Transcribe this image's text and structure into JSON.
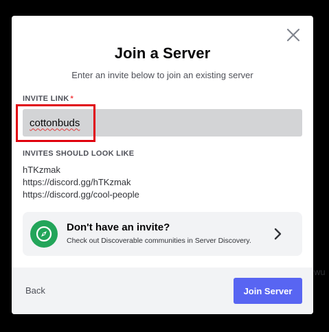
{
  "modal": {
    "title": "Join a Server",
    "subtitle": "Enter an invite below to join an existing server"
  },
  "invite_field": {
    "label": "INVITE LINK",
    "required_marker": "*",
    "value": "cottonbuds"
  },
  "examples": {
    "label": "INVITES SHOULD LOOK LIKE",
    "items": [
      "hTKzmak",
      "https://discord.gg/hTKzmak",
      "https://discord.gg/cool-people"
    ]
  },
  "discovery": {
    "title": "Don't have an invite?",
    "subtitle": "Check out Discoverable communities in Server Discovery.",
    "icon": "compass-icon"
  },
  "footer": {
    "back_label": "Back",
    "join_label": "Join Server"
  },
  "colors": {
    "accent": "#5865f2",
    "discovery_icon_bg": "#23a55a",
    "required": "#f23f43",
    "highlight_box": "#e0000d"
  },
  "backdrop_text": "wu"
}
